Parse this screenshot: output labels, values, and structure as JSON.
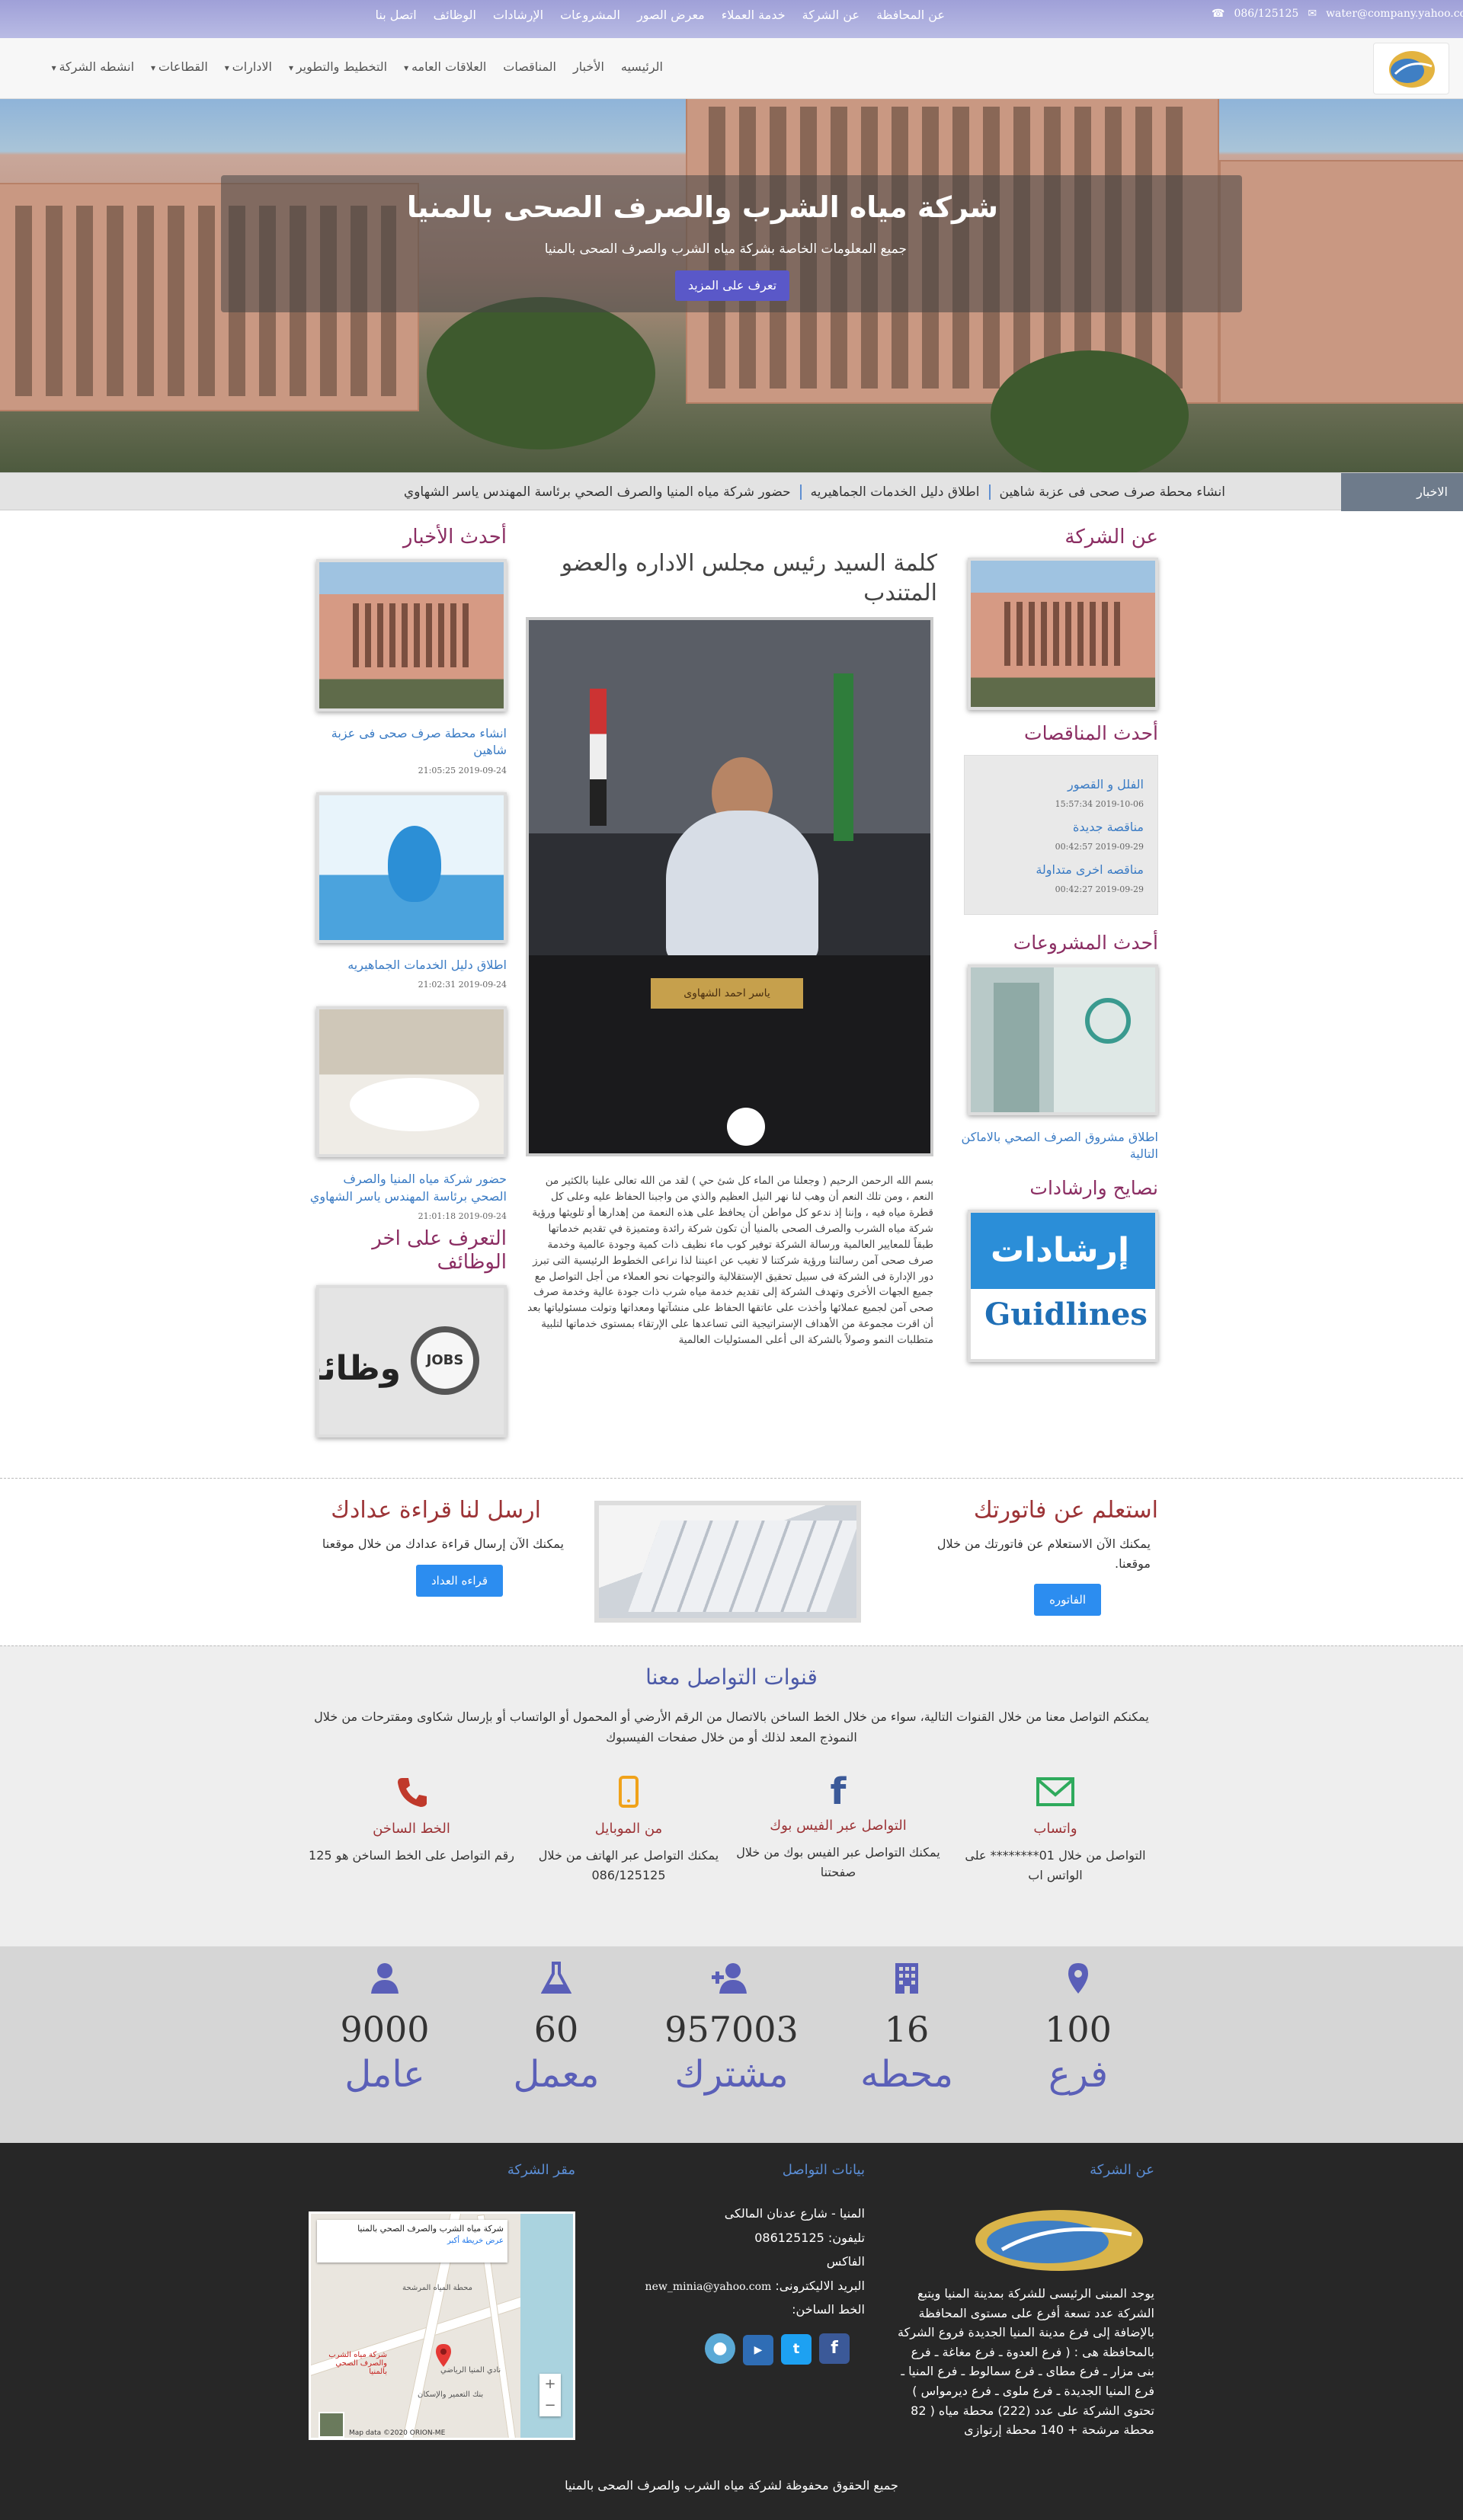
{
  "topbar": {
    "links": [
      "عن المحافظة",
      "عن الشركة",
      "خدمة العملاء",
      "معرض الصور",
      "المشروعات",
      "الإرشادات",
      "الوظائف",
      "اتصل بنا"
    ],
    "phone": "086/125125",
    "email": "water@company.yahoo.com"
  },
  "nav": {
    "items": [
      {
        "label": "الرئيسيه",
        "dropdown": false
      },
      {
        "label": "الأخبار",
        "dropdown": false
      },
      {
        "label": "المناقصات",
        "dropdown": false
      },
      {
        "label": "العلاقات العامه",
        "dropdown": true
      },
      {
        "label": "التخطيط والتطوير",
        "dropdown": true
      },
      {
        "label": "الادارات",
        "dropdown": true
      },
      {
        "label": "القطاعات",
        "dropdown": true
      },
      {
        "label": "انشطه الشركة",
        "dropdown": true
      }
    ]
  },
  "hero": {
    "title": "شركة مياه الشرب والصرف الصحى بالمنيا",
    "subtitle": "جميع المعلومات الخاصة بشركة مياه الشرب والصرف الصحى بالمنيا",
    "button": "تعرف على المزيد"
  },
  "ticker": {
    "label": "الاخبار",
    "items": [
      "انشاء محطة صرف صحى فى عزبة شاهين",
      "اطلاق دليل الخدمات الجماهيريه",
      "حضور شركة مياه المنيا والصرف الصحي برئاسة المهندس ياسر الشهاوي"
    ]
  },
  "about": {
    "title": "عن الشركة"
  },
  "tenders": {
    "title": "أحدث المناقصات",
    "items": [
      {
        "title": "الفلل و القصور",
        "date": "2019-10-06 15:57:34"
      },
      {
        "title": "مناقصة جديدة",
        "date": "2019-09-29 00:42:57"
      },
      {
        "title": "مناقصه اخرى متداولة",
        "date": "2019-09-29 00:42:27"
      }
    ]
  },
  "projects": {
    "title": "أحدث المشروعات",
    "item": "اطلاق مشروق الصرف الصحي بالاماكن التالية"
  },
  "guidelines": {
    "title": "نصايح وارشادات",
    "img_ar": "إرشادات",
    "img_en": "Guidlines"
  },
  "chairman": {
    "title": "كلمة السيد رئيس مجلس الاداره والعضو المتندب",
    "nameplate": "ياسر احمد الشهاوى",
    "text": "بسم الله الرحمن الرحيم ( وجعلنا من الماء كل شئ حي ) لقد من الله تعالى علينا بالكثير من النعم ، ومن تلك النعم أن وهب لنا نهر النيل العظيم والذي من واجبنا الحفاظ عليه وعلى كل قطرة مياه فيه ، وإننا إذ ندعو كل مواطن أن يحافظ على هذه النعمة من إهدارها أو تلويثها ورؤية شركة مياه الشرب والصرف الصحى بالمنيا أن تكون شركة رائدة ومتميزة في تقديم خدماتها طبقاً للمعايير العالمية ورسالة الشركة توفير كوب ماء نظيف ذات كمية وجودة عالمية وخدمة صرف صحى آمن رسالتنا ورؤية شركتنا لا تغيب عن اعيننا لذا نراعى الخطوط الرئيسية التى تبرز دور الإدارة فى الشركة فى سبيل تحقيق الإستقلالية والتوجهات نحو العملاء من أجل التواصل مع جميع الجهات الأخرى وتهدف الشركة إلى تقديم خدمة مياه شرب ذات جودة عالية وخدمة صرف صحى آمن لجميع عملائها وأخذت على عاتقها الحفاظ على منشآتها ومعداتها وتولت مسئولياتها بعد أن اقرت مجموعة من الأهداف الإستراتيجية التى تساعدها على الإرتقاء بمستوى خدماتها لتلبية متطلبات النمو وصولاً بالشركة الى أعلى المسئوليات العالمية"
  },
  "news": {
    "title": "أحدث الأخبار",
    "items": [
      {
        "title": "انشاء محطة صرف صحى فى عزبة شاهين",
        "date": "2019-09-24 21:05:25"
      },
      {
        "title": "اطلاق دليل الخدمات الجماهيريه",
        "date": "2019-09-24 21:02:31"
      },
      {
        "title": "حضور شركة مياه المنيا والصرف الصحي برئاسة المهندس ياسر الشهاوي",
        "date": "2019-09-24 21:01:18"
      }
    ]
  },
  "jobs": {
    "title": "التعرف على اخر الوظائف",
    "img_text": "وظائف",
    "img_tag": "JOBS"
  },
  "services": {
    "bill": {
      "title": "استعلم عن فاتورتك",
      "text": "يمكنك الآن الاستعلام عن فاتورتك من خلال موقعنا.",
      "button": "الفاتوره"
    },
    "meter": {
      "title": "ارسل لنا قراءة عدادك",
      "text": "يمكنك الآن إرسال قراءة عدادك من خلال موقعنا",
      "button": "قراءه العداد"
    }
  },
  "contact": {
    "title": "قنوات التواصل معنا",
    "intro": "يمكنكم التواصل معنا من خلال القنوات التالية، سواء من خلال الخط الساخن بالاتصال من الرقم الأرضي أو المحمول أو الواتساب أو بإرسال شكاوى ومقترحات من خلال النموذج المعد لذلك أو من خلال صفحات الفيسبوك",
    "channels": [
      {
        "icon": "envelope-icon",
        "title": "واتساب",
        "text": "التواصل من خلال 01******** على الواتس اب",
        "color": "#2eaa5c"
      },
      {
        "icon": "facebook-icon",
        "title": "التواصل عبر الفيس بوك",
        "text": "يمكنك التواصل عبر الفيس بوك من خلال صفحتنا",
        "color": "#3b5998"
      },
      {
        "icon": "mobile-icon",
        "title": "من الموبايل",
        "text": "يمكنك التواصل عبر الهاتف من خلال 086/125125",
        "color": "#f0a21a"
      },
      {
        "icon": "phone-icon",
        "title": "الخط الساخن",
        "text": "رقم التواصل على الخط الساخن هو 125",
        "color": "#c0392b"
      }
    ]
  },
  "stats": [
    {
      "icon": "map-marker-icon",
      "number": "100",
      "label": "فرع"
    },
    {
      "icon": "building-icon",
      "number": "16",
      "label": "محطه"
    },
    {
      "icon": "user-plus-icon",
      "number": "957003",
      "label": "مشترك"
    },
    {
      "icon": "flask-icon",
      "number": "60",
      "label": "معمل"
    },
    {
      "icon": "user-icon",
      "number": "9000",
      "label": "عامل"
    }
  ],
  "footer": {
    "about_title": "عن الشركة",
    "about_text": "يوجد المبنى الرئيسى للشركة بمدينة المنيا ويتبع الشركة عدد تسعة أفرع على مستوى المحافظة بالإضافة إلى فرع مدينة المنيا الجديدة فروع الشركة بالمحافظة هى : ( فرع العدوة ـ فرع مغاغة ـ فرع بنى مزار ـ فرع مطاى ـ فرع سمالوط ـ فرع المنيا ـ فرع المنيا الجديدة ـ فرع ملوى ـ فرع ديرمواس ) تحتوى الشركة على عدد (222) محطة مياه ( 82 محطة مرشحة + 140 محطة إرتوازى",
    "contact_title": "بيانات التواصل",
    "address": "المنيا - شارع عدنان المالكى",
    "phone_label": "تليفون:",
    "phone": "086125125",
    "fax_label": "الفاكس",
    "email_label": "البريد الاليكترونى:",
    "email": "new_minia@yahoo.com",
    "hotline_label": "الخط الساخن:",
    "hq_title": "مقر الشركة",
    "map_label": "شركة مياه الشرب والصرف الصحي بالمنيا",
    "map_sub": "عرض خريطة أكبر",
    "map_pin": "شركة مياه الشرب والصرف الصحي بالمنيا",
    "map_place1": "محطة المياه المرشحة",
    "map_place2": "نادي المنيا الرياضي",
    "map_place3": "بنك التعمير والإسكان",
    "map_credit": "Map data ©2020 ORION-ME",
    "copyright": "جميع الحقوق محفوظة لشركة مياه الشرب والصرف الصحى بالمنيا"
  }
}
